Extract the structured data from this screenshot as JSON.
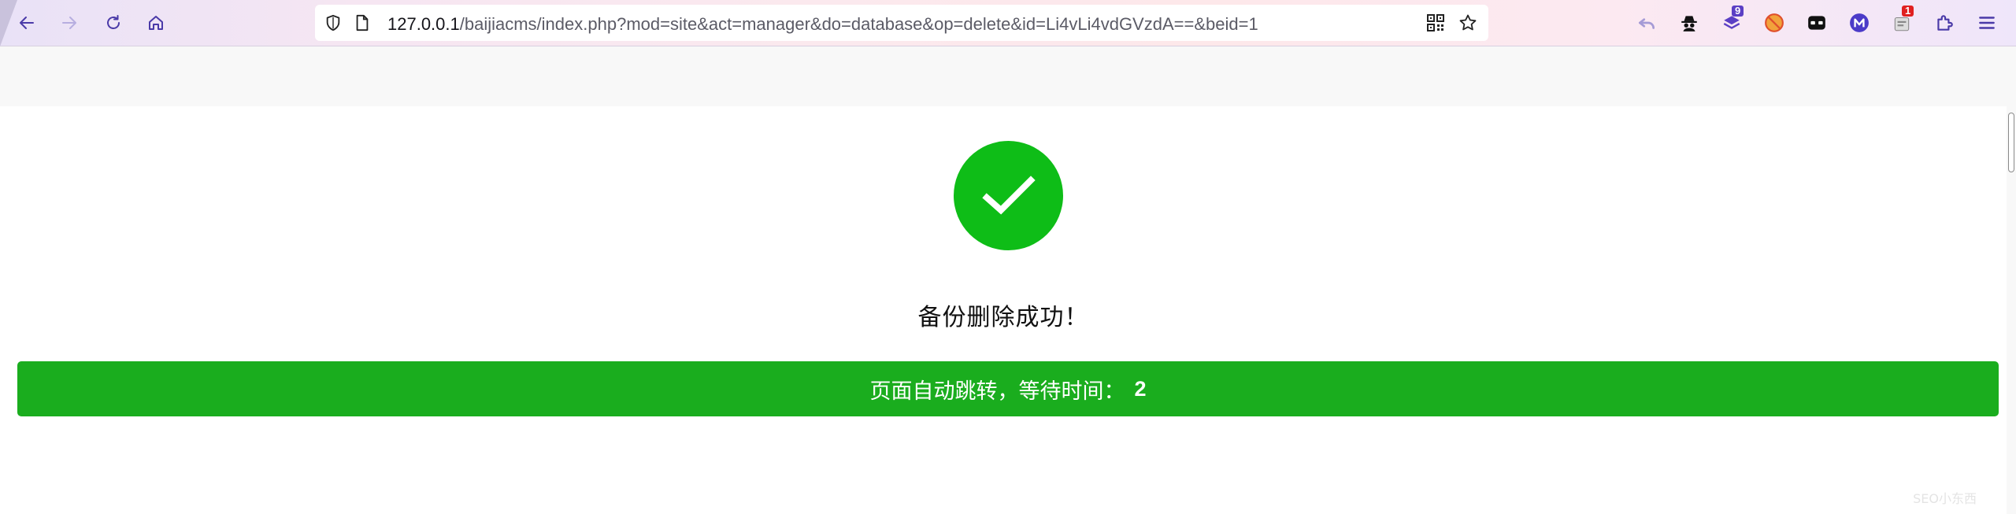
{
  "browser": {
    "url_host": "127.0.0.1",
    "url_path": "/baijiacms/index.php?mod=site&act=manager&do=database&op=delete&id=Li4vLi4vdGVzdA==&beid=1",
    "extensions": [
      {
        "name": "spy-icon",
        "badge": ""
      },
      {
        "name": "layers-icon",
        "badge": "9"
      },
      {
        "name": "cookie-block-icon",
        "badge": ""
      },
      {
        "name": "mask-icon",
        "badge": ""
      },
      {
        "name": "m-icon",
        "badge": ""
      },
      {
        "name": "extension-badge-icon",
        "badge": "1"
      }
    ]
  },
  "page": {
    "message": "备份删除成功！",
    "redirect_label": "页面自动跳转，等待时间：",
    "redirect_count": "2",
    "watermark": "SEO小东西"
  },
  "colors": {
    "success": "#0ebd17",
    "bar": "#1aad1e"
  }
}
